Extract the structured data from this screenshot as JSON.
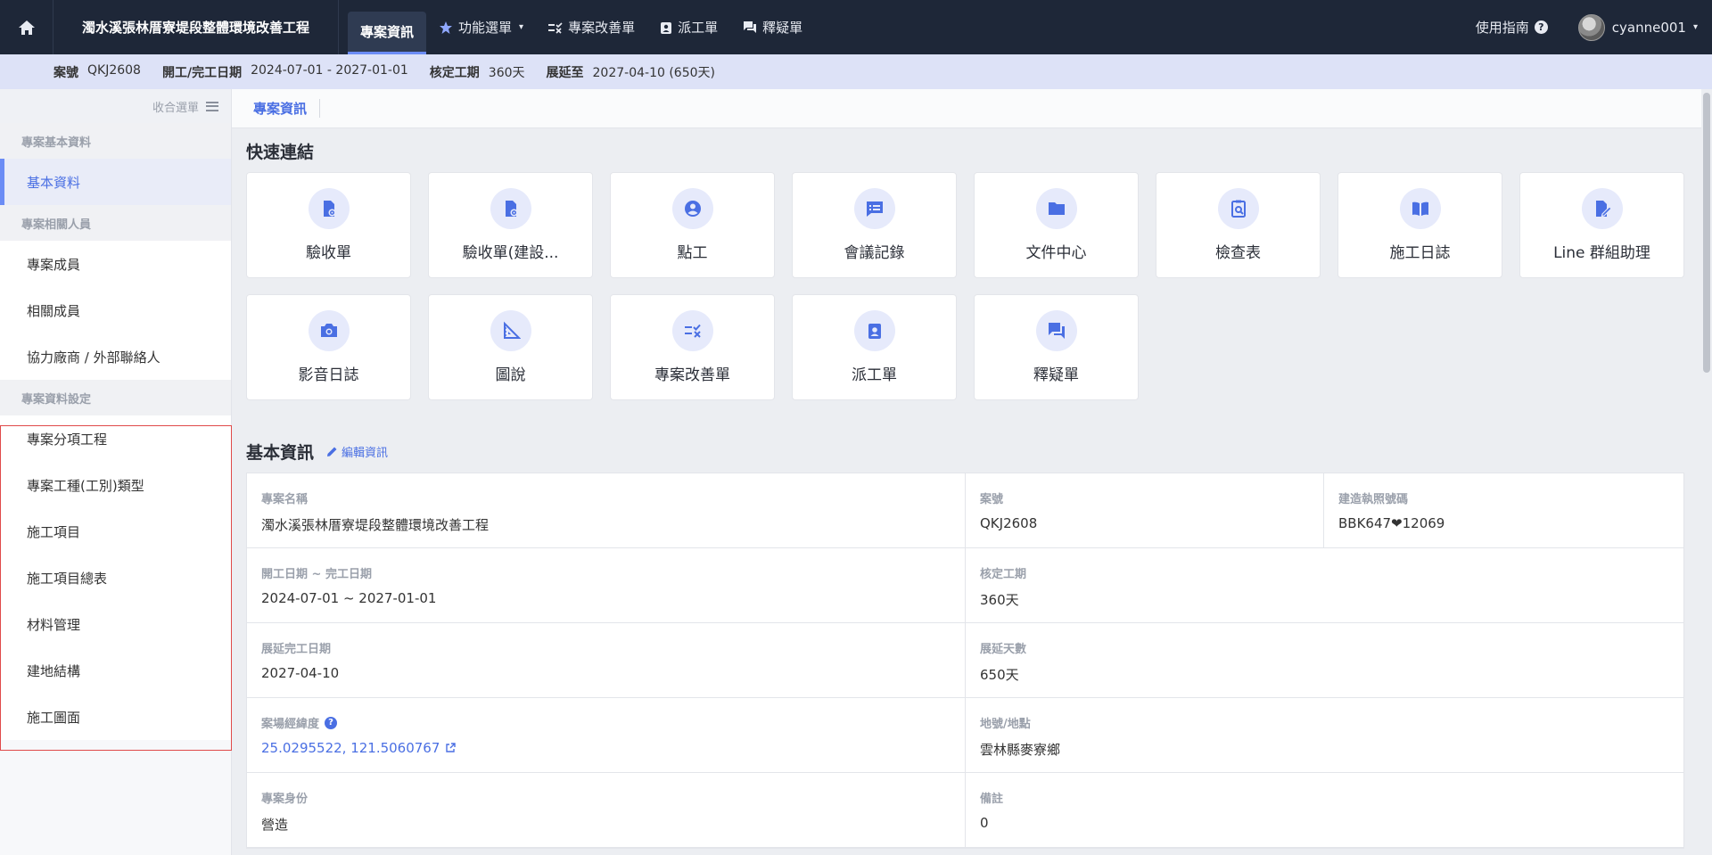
{
  "topbar": {
    "project_title": "濁水溪張林厝寮堤段整體環境改善工程",
    "nav": [
      {
        "label": "專案資訊",
        "icon": ""
      },
      {
        "label": "功能選單",
        "icon": "star-icon"
      },
      {
        "label": "專案改善單",
        "icon": "list-check-icon"
      },
      {
        "label": "派工單",
        "icon": "badge-icon"
      },
      {
        "label": "釋疑單",
        "icon": "chat-icon"
      }
    ],
    "guide_label": "使用指南",
    "username": "cyanne001"
  },
  "infobar": {
    "case_no_label": "案號",
    "case_no": "QKJ2608",
    "dates_label": "開工/完工日期",
    "dates": "2024-07-01 - 2027-01-01",
    "duration_label": "核定工期",
    "duration": "360天",
    "extend_label": "展延至",
    "extend": "2027-04-10 (650天)"
  },
  "sidebar": {
    "collapse_label": "收合選單",
    "sections": [
      {
        "title": "專案基本資料",
        "items": [
          "基本資料"
        ]
      },
      {
        "title": "專案相關人員",
        "items": [
          "專案成員",
          "相關成員",
          "協力廠商 / 外部聯絡人"
        ]
      },
      {
        "title": "專案資料設定",
        "items": [
          "專案分項工程",
          "專案工種(工別)類型",
          "施工項目",
          "施工項目總表",
          "材料管理",
          "建地結構",
          "施工圖面"
        ]
      }
    ]
  },
  "main": {
    "subtab": "專案資訊",
    "quick_links_title": "快速連結",
    "quick_links": [
      {
        "label": "驗收單",
        "icon": "doc-gear-icon"
      },
      {
        "label": "驗收單(建設...",
        "icon": "doc-gear-icon"
      },
      {
        "label": "點工",
        "icon": "person-icon"
      },
      {
        "label": "會議記錄",
        "icon": "message-icon"
      },
      {
        "label": "文件中心",
        "icon": "folder-icon"
      },
      {
        "label": "檢查表",
        "icon": "clipboard-search-icon"
      },
      {
        "label": "施工日誌",
        "icon": "book-icon"
      },
      {
        "label": "Line 群組助理",
        "icon": "edit-doc-icon"
      },
      {
        "label": "影音日誌",
        "icon": "camera-icon"
      },
      {
        "label": "圖說",
        "icon": "ruler-icon"
      },
      {
        "label": "專案改善單",
        "icon": "list-check-icon"
      },
      {
        "label": "派工單",
        "icon": "badge-icon"
      },
      {
        "label": "釋疑單",
        "icon": "chat-icon"
      }
    ],
    "basic_title": "基本資訊",
    "edit_label": "編輯資訊",
    "fields": {
      "name_label": "專案名稱",
      "name": "濁水溪張林厝寮堤段整體環境改善工程",
      "case_label": "案號",
      "case": "QKJ2608",
      "permit_label": "建造執照號碼",
      "permit": "BBK647❤12069",
      "period_label": "開工日期 ~ 完工日期",
      "period": "2024-07-01 ~ 2027-01-01",
      "approved_label": "核定工期",
      "approved": "360天",
      "ext_date_label": "展延完工日期",
      "ext_date": "2027-04-10",
      "ext_days_label": "展延天數",
      "ext_days": "650天",
      "coords_label": "案場經緯度",
      "coords": "25.0295522, 121.5060767",
      "addr_label": "地號/地點",
      "addr": "雲林縣麥寮鄉",
      "role_label": "專案身份",
      "role": "營造",
      "note_label": "備註",
      "note": "0"
    }
  }
}
